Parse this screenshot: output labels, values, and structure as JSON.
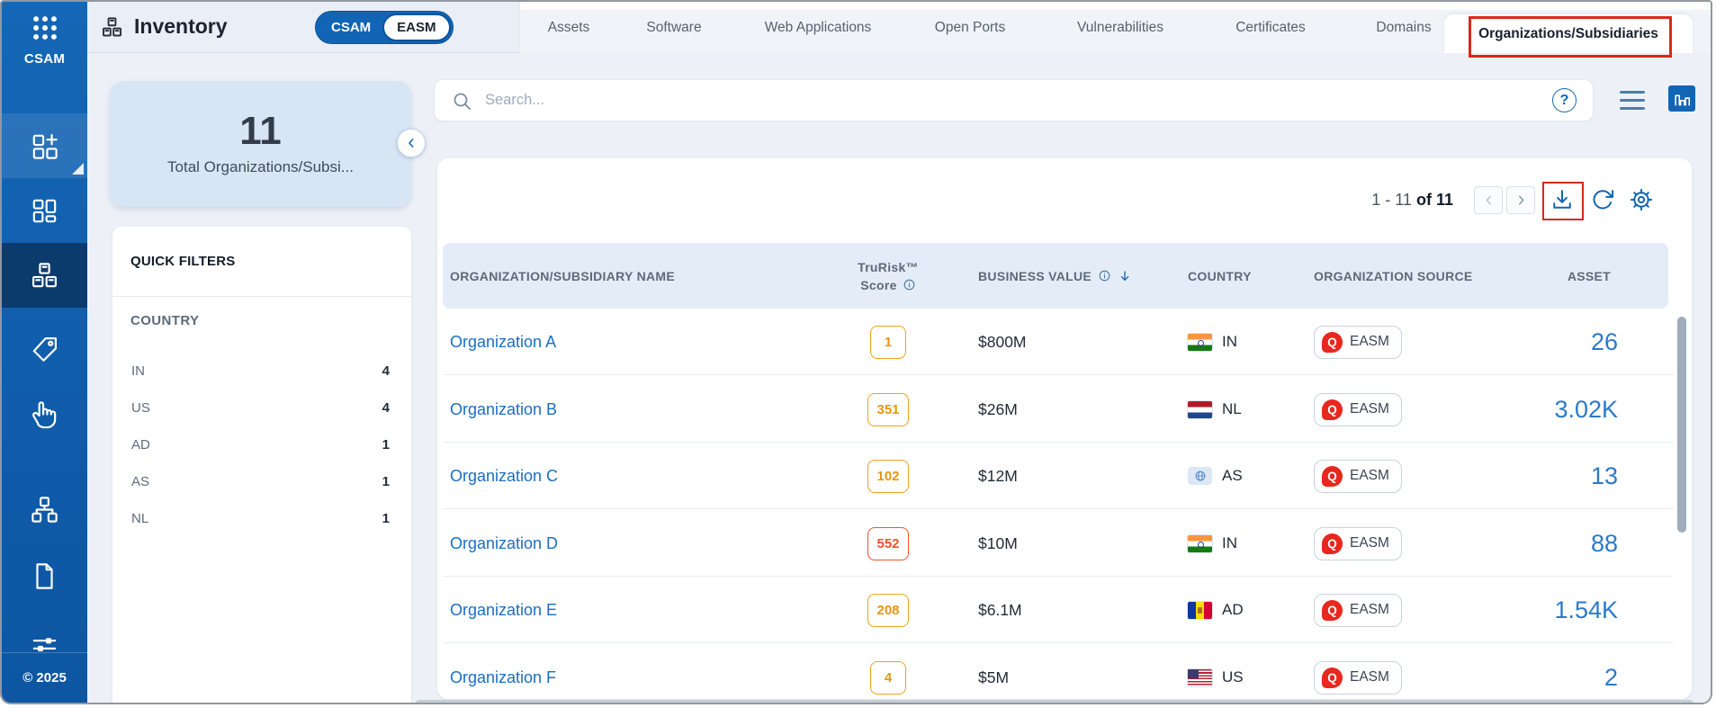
{
  "sidebar": {
    "logo_icon": "apps-grid-icon",
    "product_label": "CSAM",
    "nav_items": [
      {
        "icon": "add-widget",
        "active": false,
        "has_corner_flag": true
      },
      {
        "icon": "dashboard",
        "active": false,
        "has_corner_flag": false
      },
      {
        "icon": "inventory-boxes",
        "active": true,
        "has_corner_flag": false
      },
      {
        "icon": "tag",
        "active": false,
        "has_corner_flag": false
      },
      {
        "icon": "hand-click",
        "active": false,
        "has_corner_flag": false
      },
      {
        "icon": "org-chart",
        "active": false,
        "has_corner_flag": false
      },
      {
        "icon": "document",
        "active": false,
        "has_corner_flag": false
      },
      {
        "icon": "sliders",
        "active": false,
        "has_corner_flag": false
      }
    ],
    "copyright": "© 2025"
  },
  "header": {
    "title": "Inventory",
    "mode_toggle": {
      "selected": "CSAM",
      "other": "EASM"
    },
    "tabs": [
      {
        "label": "Assets",
        "active": false
      },
      {
        "label": "Software",
        "active": false
      },
      {
        "label": "Web Applications",
        "active": false
      },
      {
        "label": "Open Ports",
        "active": false
      },
      {
        "label": "Vulnerabilities",
        "active": false
      },
      {
        "label": "Certificates",
        "active": false
      },
      {
        "label": "Domains",
        "active": false
      },
      {
        "label": "Organizations/Subsidiaries",
        "active": true,
        "annotated": true
      }
    ]
  },
  "summary_card": {
    "value": "11",
    "label": "Total Organizations/Subsi..."
  },
  "quick_filters": {
    "title": "QUICK FILTERS",
    "group_title": "COUNTRY",
    "items": [
      {
        "label": "IN",
        "count": "4"
      },
      {
        "label": "US",
        "count": "4"
      },
      {
        "label": "AD",
        "count": "1"
      },
      {
        "label": "AS",
        "count": "1"
      },
      {
        "label": "NL",
        "count": "1"
      }
    ]
  },
  "search": {
    "placeholder": "Search...",
    "help_glyph": "?"
  },
  "toolbar": {
    "pagination_range": "1 - 11",
    "pagination_of": "of",
    "pagination_total": "11"
  },
  "table": {
    "source_logo_glyph": "Q",
    "columns": {
      "name": "ORGANIZATION/SUBSIDIARY NAME",
      "trurisk_line1": "TruRisk™",
      "trurisk_line2": "Score",
      "business_value": "BUSINESS VALUE",
      "country": "COUNTRY",
      "source": "ORGANIZATION SOURCE",
      "asset": "ASSET"
    },
    "rows": [
      {
        "name": "Organization A",
        "trurisk_score": "1",
        "score_level": "orange",
        "business_value": "$800M",
        "country_code": "IN",
        "source": "EASM",
        "assets": "26"
      },
      {
        "name": "Organization B",
        "trurisk_score": "351",
        "score_level": "orange",
        "business_value": "$26M",
        "country_code": "NL",
        "source": "EASM",
        "assets": "3.02K"
      },
      {
        "name": "Organization C",
        "trurisk_score": "102",
        "score_level": "orange",
        "business_value": "$12M",
        "country_code": "AS",
        "source": "EASM",
        "assets": "13"
      },
      {
        "name": "Organization D",
        "trurisk_score": "552",
        "score_level": "red",
        "business_value": "$10M",
        "country_code": "IN",
        "source": "EASM",
        "assets": "88"
      },
      {
        "name": "Organization E",
        "trurisk_score": "208",
        "score_level": "orange",
        "business_value": "$6.1M",
        "country_code": "AD",
        "source": "EASM",
        "assets": "1.54K"
      },
      {
        "name": "Organization F",
        "trurisk_score": "4",
        "score_level": "orange",
        "business_value": "$5M",
        "country_code": "US",
        "source": "EASM",
        "assets": "2"
      }
    ]
  },
  "colors": {
    "accent": "#1266b1",
    "annotation_red": "#da291c",
    "score_orange": "#f0a21c",
    "score_red": "#f4512c",
    "asset_blue": "#2b7ac9",
    "easm_logo_red": "#e8271e",
    "sidebar_blue": "#1164b0"
  }
}
